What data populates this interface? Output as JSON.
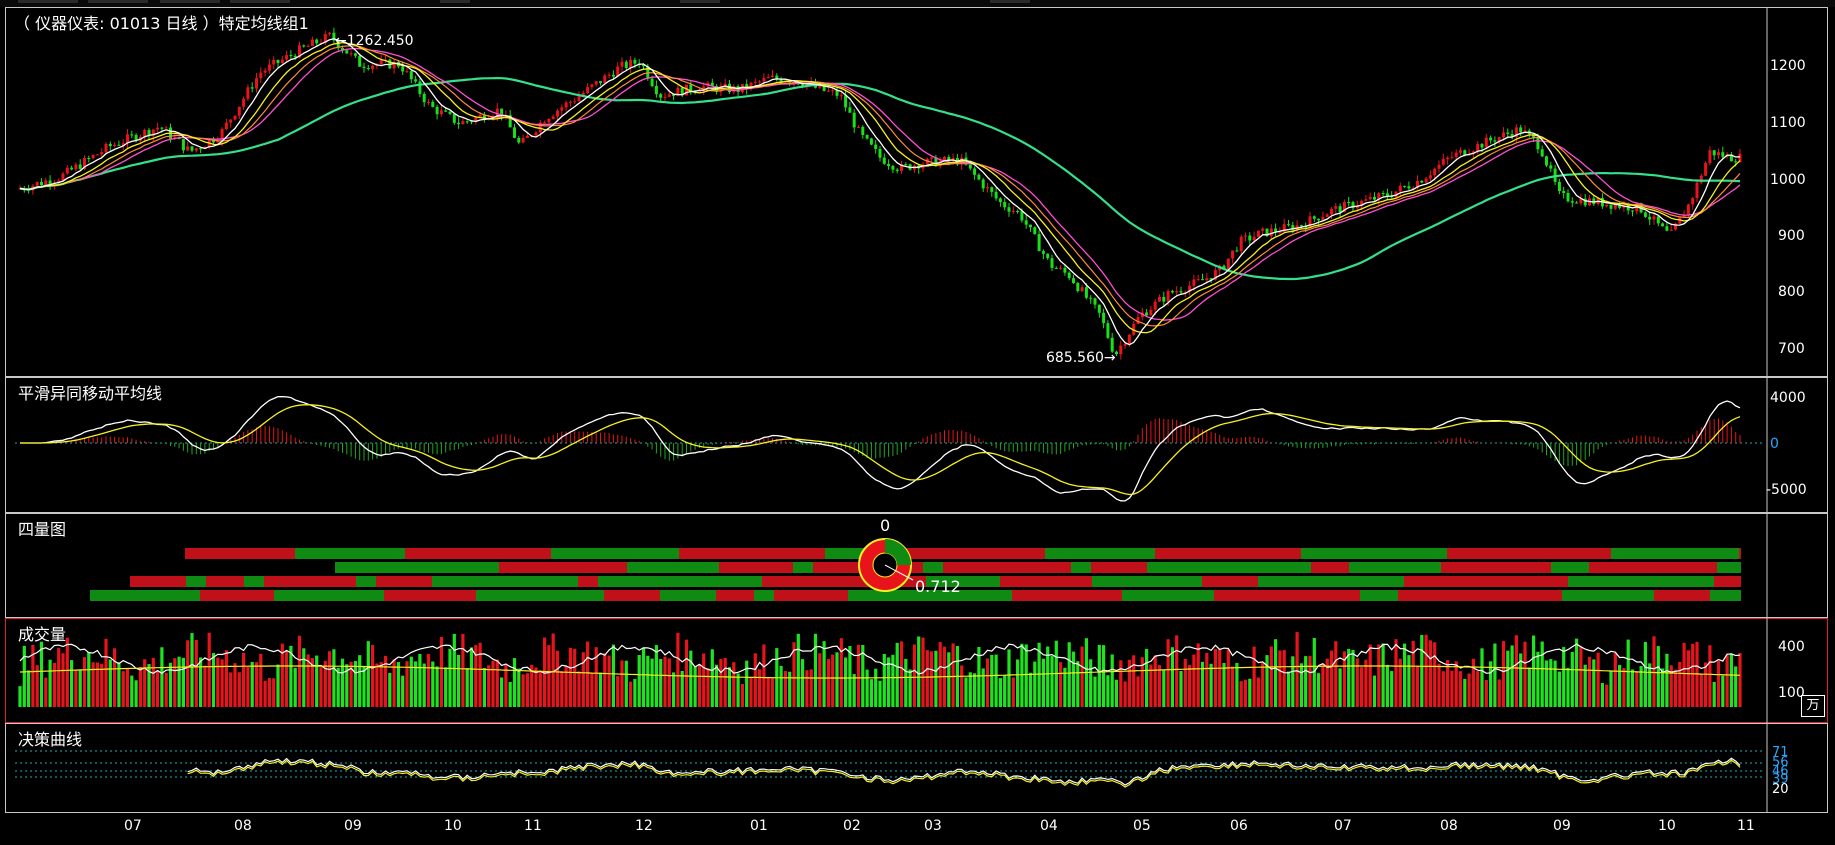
{
  "main_title": "（ 仪器仪表: 01013 日线 ）特定均线组1",
  "price": {
    "high_label": "←1262.450",
    "low_label": "685.560→",
    "axis": [
      "1200",
      "1100",
      "1000",
      "900",
      "800",
      "700"
    ],
    "ylim": [
      680,
      1290
    ]
  },
  "macd": {
    "title": "平滑异同移动平均线",
    "axis": [
      "4000",
      "0",
      "-5000"
    ]
  },
  "quad": {
    "title": "四量图",
    "top_value": "0",
    "ratio": "0.712"
  },
  "volume": {
    "title": "成交量",
    "axis": [
      "400",
      "100"
    ],
    "unit": "万"
  },
  "decision": {
    "title": "决策曲线",
    "axis": [
      "71",
      "56",
      "46",
      "39",
      "20"
    ]
  },
  "months": [
    "07",
    "08",
    "09",
    "10",
    "11",
    "12",
    "01",
    "02",
    "03",
    "04",
    "05",
    "06",
    "07",
    "08",
    "09",
    "10",
    "11"
  ],
  "colors": {
    "up": "#e8131b",
    "down": "#18e01a",
    "ma_white": "#ffffff",
    "ma_yellow": "#f7f021",
    "ma_green": "#35e08a",
    "ma_pink": "#ff4fd0",
    "axis_zero": "#29a8ff"
  }
}
